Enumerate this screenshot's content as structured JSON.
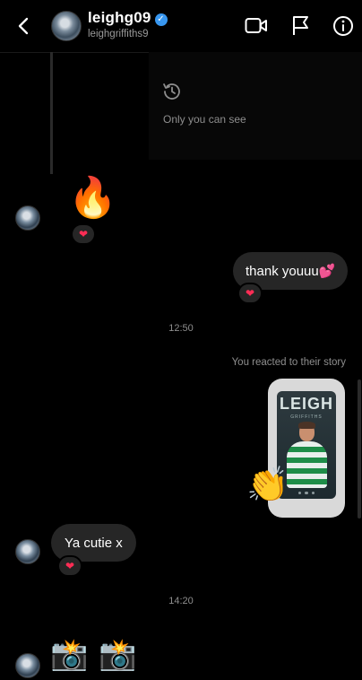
{
  "header": {
    "display_name": "leighg09",
    "username": "leighgriffiths9",
    "verified_mark": "✓",
    "icons": [
      "back-chevron-icon",
      "video-camera-icon",
      "flag-icon",
      "info-icon"
    ]
  },
  "story_notice": {
    "text": "Only you can see"
  },
  "messages": {
    "fire_emoji": "🔥",
    "heart_reaction": "❤",
    "thank_text": "thank youuu💕",
    "time_1250": "12:50",
    "reacted_label": "You reacted to their story",
    "story_title": "LEIGH",
    "story_sub": "GRIFFITHS",
    "clap_emoji": "👏",
    "cutie_text": "Ya cutie x",
    "time_1420": "14:20",
    "camera_emoji": "📸"
  },
  "colors": {
    "accent_blue": "#3897f0",
    "bubble": "#262626",
    "heart": "#ff2d55"
  }
}
